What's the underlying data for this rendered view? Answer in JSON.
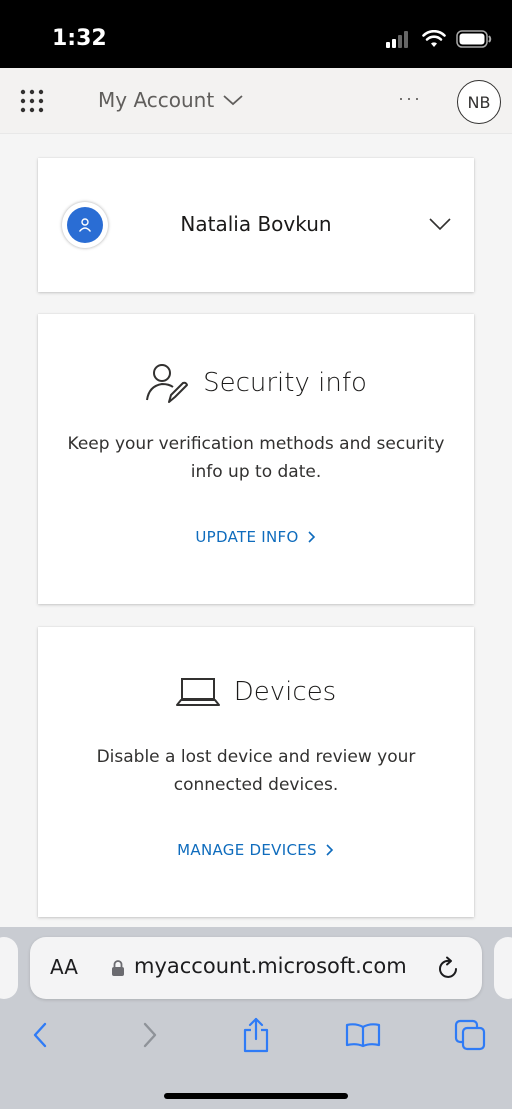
{
  "status_bar": {
    "time": "1:32"
  },
  "header": {
    "title": "My Account",
    "more_label": "···",
    "avatar_initials": "NB"
  },
  "profile": {
    "name": "Natalia Bovkun"
  },
  "security_info": {
    "title": "Security info",
    "description": "Keep your verification methods and security info up to date.",
    "link_label": "UPDATE INFO"
  },
  "devices": {
    "title": "Devices",
    "description": "Disable a lost device and review your connected devices.",
    "link_label": "MANAGE DEVICES"
  },
  "browser": {
    "text_size_label": "AA",
    "url": "myaccount.microsoft.com"
  },
  "colors": {
    "accent": "#0f6cbd",
    "avatar_blue": "#2a6dd4",
    "toolbar_icon": "#2f7bf6"
  },
  "icons": [
    "apps-grid-icon",
    "chevron-down-icon",
    "user-edit-icon",
    "laptop-icon",
    "lock-icon",
    "reload-icon",
    "back-icon",
    "forward-icon",
    "share-icon",
    "bookmarks-icon",
    "tabs-icon"
  ]
}
